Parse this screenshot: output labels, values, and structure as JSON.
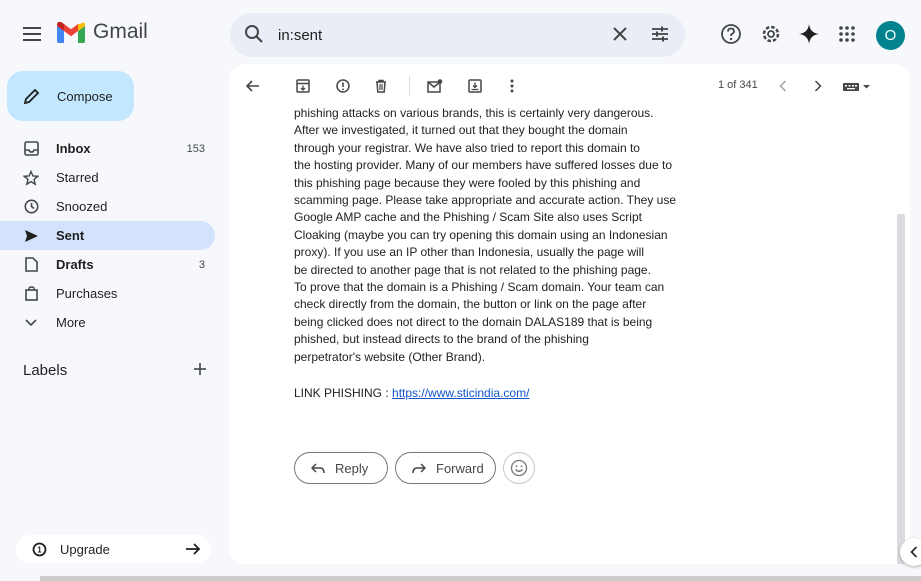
{
  "app": {
    "title": "Gmail"
  },
  "search": {
    "value": "in:sent"
  },
  "compose": {
    "label": "Compose"
  },
  "sidebar": {
    "items": [
      {
        "label": "Inbox",
        "count": "153"
      },
      {
        "label": "Starred",
        "count": ""
      },
      {
        "label": "Snoozed",
        "count": ""
      },
      {
        "label": "Sent",
        "count": ""
      },
      {
        "label": "Drafts",
        "count": "3"
      },
      {
        "label": "Purchases",
        "count": ""
      },
      {
        "label": "More",
        "count": ""
      }
    ],
    "labels_heading": "Labels",
    "upgrade_label": "Upgrade"
  },
  "account": {
    "initial": "O",
    "avatar_color": "#00838f"
  },
  "toolbar": {
    "pager": "1 of 341"
  },
  "email": {
    "lines": [
      "phishing attacks on various brands, this is certainly very dangerous.",
      "After we investigated, it turned out that they bought the domain",
      "through your registrar. We have also tried to report this domain to",
      "the hosting provider. Many of our members have suffered losses due to",
      "this phishing page because they were fooled by this phishing and",
      "scamming page. Please take appropriate and accurate action. They use",
      "Google AMP cache and the Phishing / Scam Site also uses Script",
      "Cloaking (maybe you can try opening this domain using an Indonesian",
      "proxy). If you use an IP other than Indonesia, usually the page will",
      "be directed to another page that is not related to the phishing page.",
      "To prove that the domain is a Phishing / Scam domain. Your team can",
      "check directly from the domain, the button or link on the page after",
      "being clicked does not direct to the domain DALAS189 that is being",
      "phished, but instead directs to the brand of the phishing",
      "perpetrator's website (Other Brand)."
    ],
    "phishing_prefix": "LINK PHISHING : ",
    "phishing_link": "https://www.sticindia.com/"
  },
  "actions": {
    "reply_label": "Reply",
    "forward_label": "Forward"
  },
  "colors": {
    "accent": "#c2e7ff",
    "active_nav": "#d3e3fd",
    "background": "#f6f8fc",
    "link": "#1155cc"
  }
}
